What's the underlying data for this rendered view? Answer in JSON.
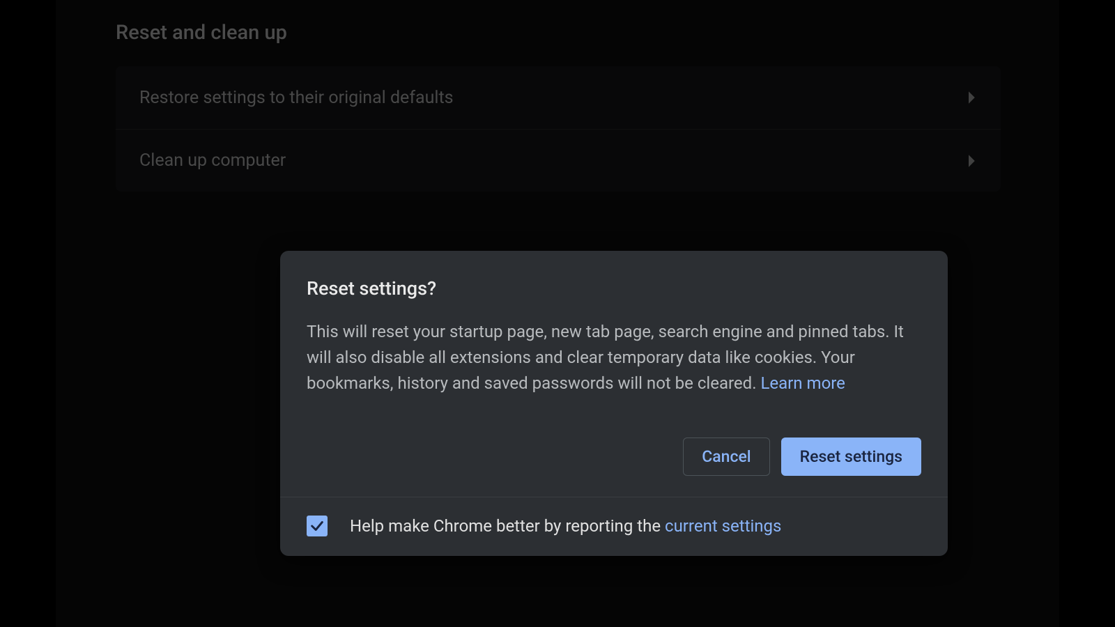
{
  "section": {
    "heading": "Reset and clean up",
    "items": [
      {
        "label": "Restore settings to their original defaults"
      },
      {
        "label": "Clean up computer"
      }
    ]
  },
  "dialog": {
    "title": "Reset settings?",
    "body_text": "This will reset your startup page, new tab page, search engine and pinned tabs. It will also disable all extensions and clear temporary data like cookies. Your bookmarks, history and saved passwords will not be cleared. ",
    "learn_more": "Learn more",
    "cancel": "Cancel",
    "confirm": "Reset settings",
    "footer_prefix": "Help make Chrome better by reporting the ",
    "footer_link": "current settings",
    "checkbox_checked": true
  },
  "colors": {
    "accent": "#8ab4f8",
    "dialog_bg": "#2c2f33"
  }
}
